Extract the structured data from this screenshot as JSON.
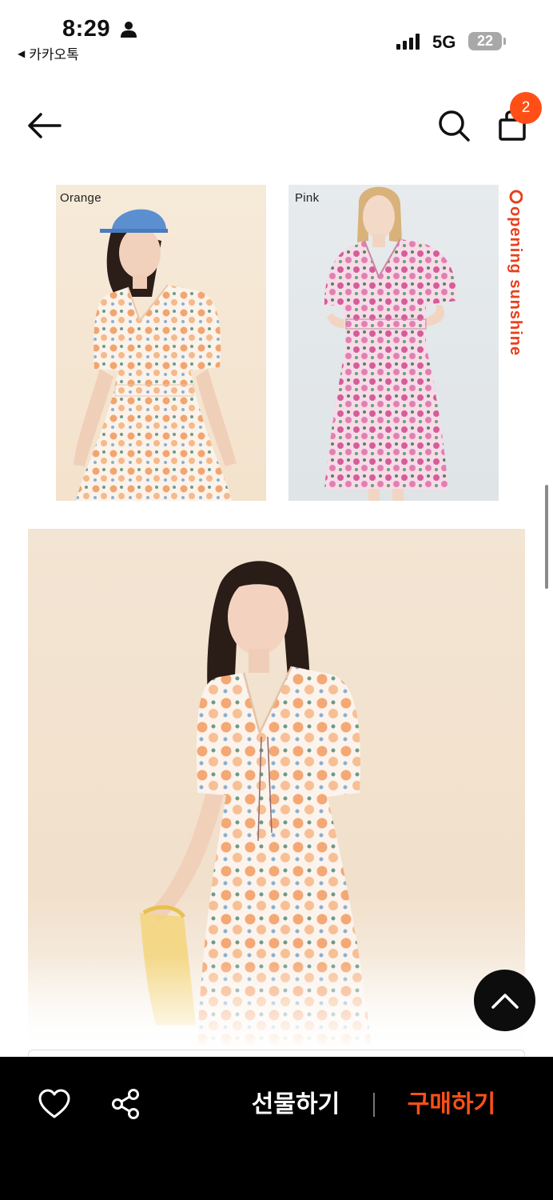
{
  "status_bar": {
    "time": "8:29",
    "back_app": "카카오톡",
    "network": "5G",
    "battery": "22"
  },
  "header": {
    "cart_count": "2"
  },
  "product": {
    "color_options": [
      {
        "label": "Orange"
      },
      {
        "label": "Pink"
      }
    ],
    "brand_tag": "opening sunshine"
  },
  "bottom_bar": {
    "gift_label": "선물하기",
    "buy_label": "구매하기"
  },
  "colors": {
    "accent": "#ff4f17",
    "bar_bg": "#000000"
  }
}
